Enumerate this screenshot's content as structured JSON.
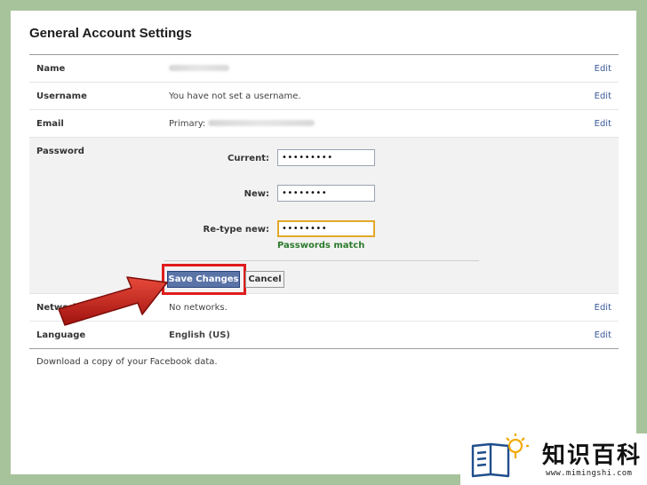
{
  "header": {
    "title": "General Account Settings"
  },
  "rows": {
    "name": {
      "label": "Name",
      "edit": "Edit"
    },
    "username": {
      "label": "Username",
      "value": "You have not set a username.",
      "edit": "Edit"
    },
    "email": {
      "label": "Email",
      "prefix": "Primary:",
      "edit": "Edit"
    },
    "password": {
      "label": "Password",
      "current_label": "Current:",
      "current_value": "•••••••••",
      "new_label": "New:",
      "new_value": "••••••••",
      "retype_label": "Re-type new:",
      "retype_value": "••••••••",
      "match_text": "Passwords match",
      "save_label": "Save Changes",
      "cancel_label": "Cancel"
    },
    "networks": {
      "label": "Networks",
      "value": "No networks.",
      "edit": "Edit"
    },
    "language": {
      "label": "Language",
      "value": "English (US)",
      "edit": "Edit"
    }
  },
  "footer": {
    "download_text": "Download a copy of your Facebook data."
  },
  "watermark": {
    "text": "知识百科",
    "url": "www.mimingshi.com"
  },
  "colors": {
    "accent": "#3b5998",
    "highlight": "#e01c1c",
    "match": "#2b7a2b",
    "focus": "#e2a829"
  }
}
